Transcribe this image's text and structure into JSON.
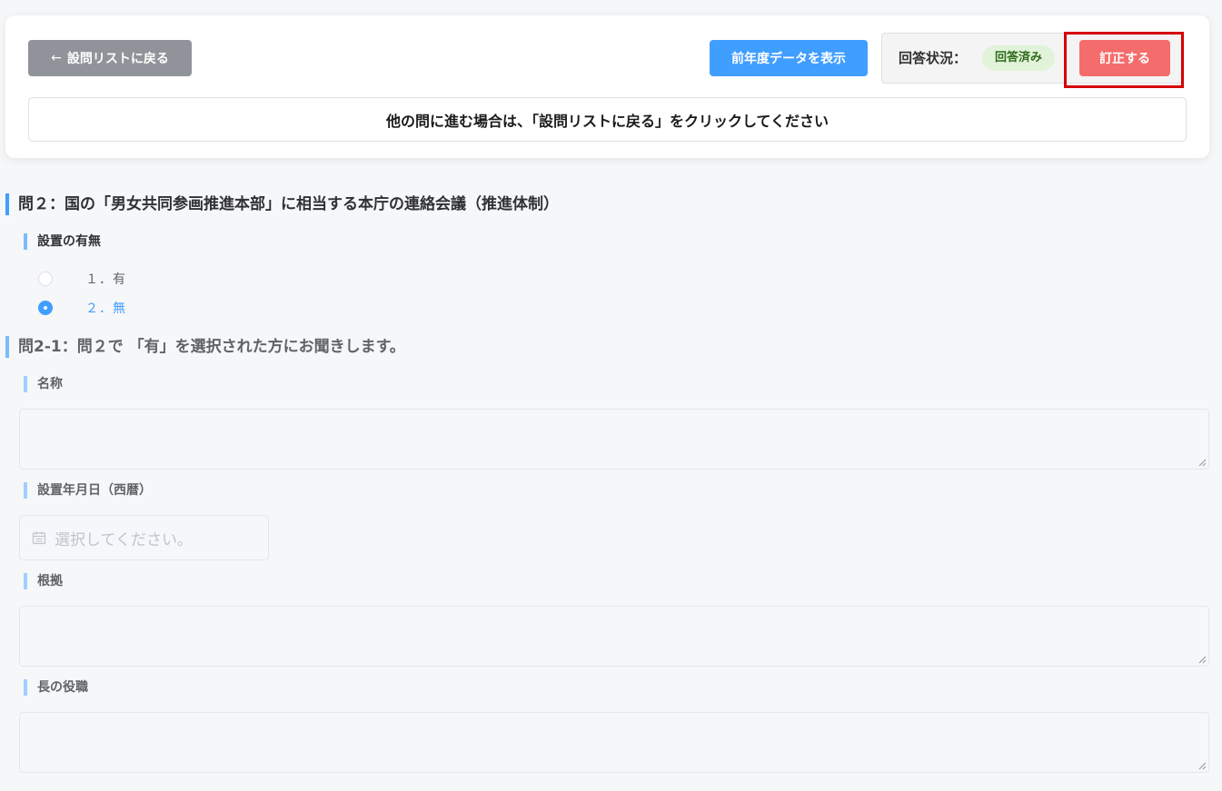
{
  "header": {
    "back_button_arrow": "←",
    "back_button_label": "設問リストに戻る",
    "prev_year_button_label": "前年度データを表示",
    "status_label": "回答状況：",
    "status_badge": "回答済み",
    "correct_button_label": "訂正する",
    "notice": "他の問に進む場合は、「設問リストに戻る」をクリックしてください"
  },
  "question2": {
    "title": "問２：国の「男女共同参画推進本部」に相当する本庁の連絡会議（推進体制）",
    "field_label": "設置の有無",
    "options": [
      {
        "label": "１．有",
        "checked": false
      },
      {
        "label": "２．無",
        "checked": true
      }
    ]
  },
  "question2_1": {
    "title": "問2-1：問２で 「有」を選択された方にお聞きします。",
    "name_label": "名称",
    "name_value": "",
    "date_label": "設置年月日（西暦）",
    "date_placeholder": "選択してください。",
    "basis_label": "根拠",
    "basis_value": "",
    "head_label": "長の役職",
    "head_value": ""
  },
  "colors": {
    "primary": "#409eff",
    "danger": "#f56c6c",
    "info": "#909399",
    "success_bg": "#e1f3d8",
    "highlight_border": "#d40000"
  }
}
